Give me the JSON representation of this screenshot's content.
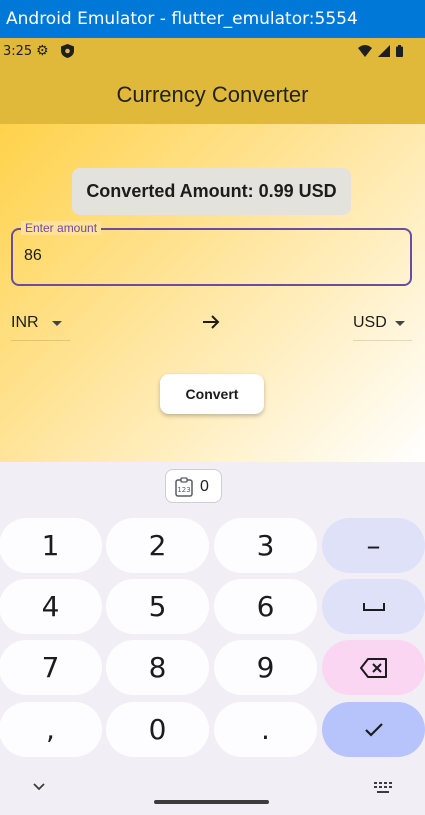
{
  "window": {
    "title": "Android Emulator - flutter_emulator:5554"
  },
  "status_bar": {
    "time": "3:25",
    "icons": [
      "gear-icon",
      "shield-icon",
      "wifi-icon",
      "signal-icon",
      "battery-icon"
    ]
  },
  "app_bar": {
    "title": "Currency Converter",
    "color": "#e0b93a"
  },
  "result": {
    "text": "Converted Amount: 0.99 USD"
  },
  "amount_field": {
    "label": "Enter amount",
    "value": "86"
  },
  "from_currency": {
    "selected": "INR"
  },
  "to_currency": {
    "selected": "USD"
  },
  "convert_button": {
    "label": "Convert"
  },
  "keyboard": {
    "clipboard_chip": {
      "value": "0",
      "icon": "clipboard-numbers-icon"
    },
    "keys": [
      {
        "label": "1"
      },
      {
        "label": "2"
      },
      {
        "label": "3"
      },
      {
        "label": "–"
      },
      {
        "label": "4"
      },
      {
        "label": "5"
      },
      {
        "label": "6"
      },
      {
        "label": "space",
        "icon": "space-icon"
      },
      {
        "label": "7"
      },
      {
        "label": "8"
      },
      {
        "label": "9"
      },
      {
        "label": "backspace",
        "icon": "backspace-icon"
      },
      {
        "label": ","
      },
      {
        "label": "0"
      },
      {
        "label": "."
      },
      {
        "label": "done",
        "icon": "check-icon"
      }
    ]
  },
  "colors": {
    "accent": "#6a4ca0",
    "keyboard_bg": "#f1eef6",
    "done_key": "#b7c4fb",
    "backspace_key": "#fbd6f3"
  }
}
